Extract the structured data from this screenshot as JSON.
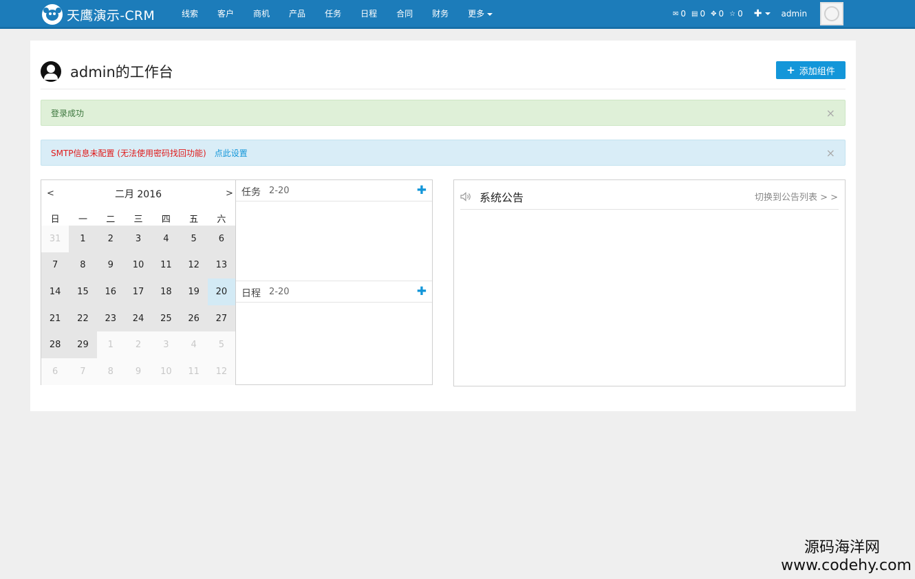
{
  "navbar": {
    "brand": "天鹰演示-CRM",
    "items": [
      "线索",
      "客户",
      "商机",
      "产品",
      "任务",
      "日程",
      "合同",
      "财务"
    ],
    "more": "更多",
    "counters": [
      {
        "icon": "mail-icon",
        "glyph": "✉",
        "value": "0"
      },
      {
        "icon": "message-icon",
        "glyph": "▤",
        "value": "0"
      },
      {
        "icon": "target-icon",
        "glyph": "✥",
        "value": "0"
      },
      {
        "icon": "star-icon",
        "glyph": "☆",
        "value": "0"
      }
    ],
    "plus": "✚",
    "user": "admin"
  },
  "page": {
    "title": "admin的工作台",
    "add_widget": "添加组件"
  },
  "alerts": {
    "success": "登录成功",
    "smtp": "SMTP信息未配置 (无法使用密码找回功能)",
    "smtp_link": "点此设置",
    "close": "×"
  },
  "calendar": {
    "prev": "<",
    "next": ">",
    "title": "二月 2016",
    "weekdays": [
      "日",
      "一",
      "二",
      "三",
      "四",
      "五",
      "六"
    ],
    "days": [
      {
        "d": "31",
        "out": true
      },
      {
        "d": "1"
      },
      {
        "d": "2"
      },
      {
        "d": "3"
      },
      {
        "d": "4"
      },
      {
        "d": "5"
      },
      {
        "d": "6"
      },
      {
        "d": "7"
      },
      {
        "d": "8"
      },
      {
        "d": "9"
      },
      {
        "d": "10"
      },
      {
        "d": "11"
      },
      {
        "d": "12"
      },
      {
        "d": "13"
      },
      {
        "d": "14"
      },
      {
        "d": "15"
      },
      {
        "d": "16"
      },
      {
        "d": "17"
      },
      {
        "d": "18"
      },
      {
        "d": "19"
      },
      {
        "d": "20",
        "today": true
      },
      {
        "d": "21"
      },
      {
        "d": "22"
      },
      {
        "d": "23"
      },
      {
        "d": "24"
      },
      {
        "d": "25"
      },
      {
        "d": "26"
      },
      {
        "d": "27"
      },
      {
        "d": "28"
      },
      {
        "d": "29"
      },
      {
        "d": "1",
        "out": true
      },
      {
        "d": "2",
        "out": true
      },
      {
        "d": "3",
        "out": true
      },
      {
        "d": "4",
        "out": true
      },
      {
        "d": "5",
        "out": true
      },
      {
        "d": "6",
        "out": true
      },
      {
        "d": "7",
        "out": true
      },
      {
        "d": "8",
        "out": true
      },
      {
        "d": "9",
        "out": true
      },
      {
        "d": "10",
        "out": true
      },
      {
        "d": "11",
        "out": true
      },
      {
        "d": "12",
        "out": true
      }
    ]
  },
  "agenda": {
    "task_label": "任务",
    "task_date": "2-20",
    "schedule_label": "日程",
    "schedule_date": "2-20",
    "add": "✚"
  },
  "notice": {
    "title": "系统公告",
    "link": "切换到公告列表 > >"
  },
  "watermark": {
    "cn": "源码海洋网",
    "url": "www.codehy.com"
  }
}
